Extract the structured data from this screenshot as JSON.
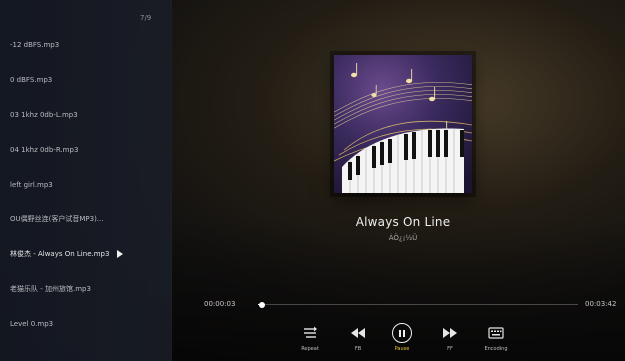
{
  "playlist": {
    "counter": "7/9",
    "items": [
      {
        "label": "-12 dBFS.mp3",
        "playing": false
      },
      {
        "label": "0 dBFS.mp3",
        "playing": false
      },
      {
        "label": "03 1khz 0db-L.mp3",
        "playing": false
      },
      {
        "label": "04 1khz 0db-R.mp3",
        "playing": false
      },
      {
        "label": "left girl.mp3",
        "playing": false
      },
      {
        "label": "OU偶野丝连(客户试音MP3)...",
        "playing": false
      },
      {
        "label": "林俊杰 - Always On Line.mp3",
        "playing": true
      },
      {
        "label": "老猫乐队 - 加州旅馆.mp3",
        "playing": false
      },
      {
        "label": "Level 0.mp3",
        "playing": false
      }
    ]
  },
  "now_playing": {
    "title": "Always On Line",
    "artist": "ÁÖ¿¡½Ü",
    "album_art_icon": "piano-music-notes-art"
  },
  "progress": {
    "current": "00:00:03",
    "total": "00:03:42",
    "fraction": 0.0135
  },
  "controls": {
    "repeat": {
      "label": "Repeat",
      "icon": "repeat-icon"
    },
    "fb": {
      "label": "FB",
      "icon": "fast-backward-icon"
    },
    "pause": {
      "label": "Pause",
      "icon": "pause-icon"
    },
    "ff": {
      "label": "FF",
      "icon": "fast-forward-icon"
    },
    "encoding": {
      "label": "Encoding",
      "icon": "encoding-icon"
    }
  },
  "colors": {
    "accent": "#e8c23a",
    "panel": "#1a1e28"
  }
}
